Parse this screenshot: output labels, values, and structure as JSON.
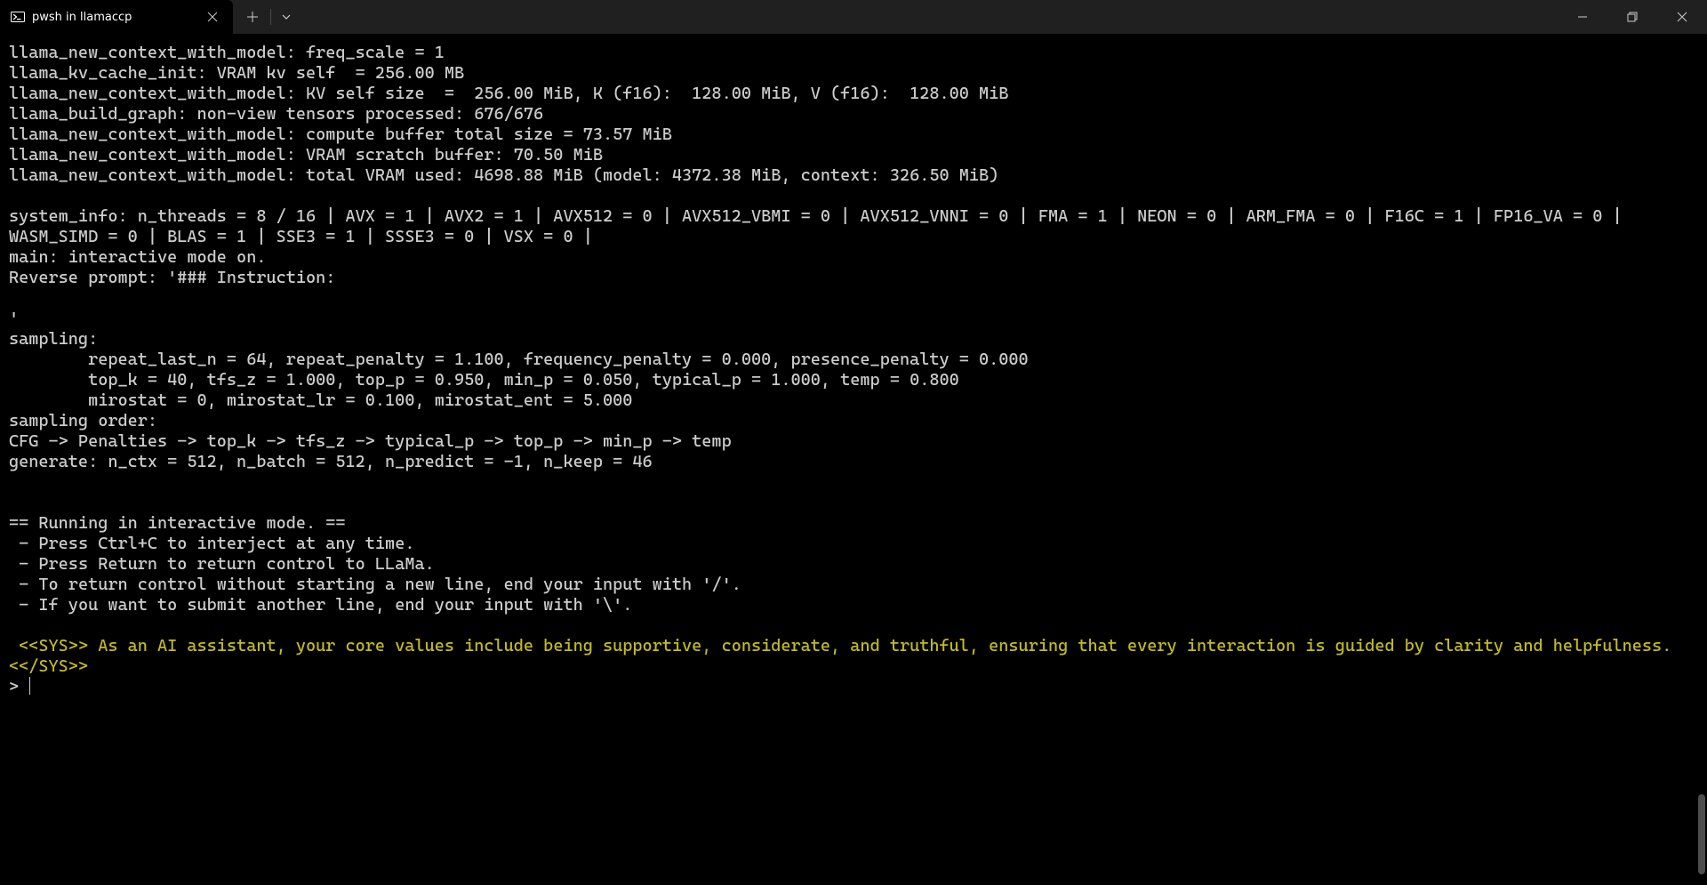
{
  "tab": {
    "title": "pwsh in llamaccp"
  },
  "terminal": {
    "lines": [
      "llama_new_context_with_model: freq_scale = 1",
      "llama_kv_cache_init: VRAM kv self  = 256.00 MB",
      "llama_new_context_with_model: KV self size  =  256.00 MiB, K (f16):  128.00 MiB, V (f16):  128.00 MiB",
      "llama_build_graph: non-view tensors processed: 676/676",
      "llama_new_context_with_model: compute buffer total size = 73.57 MiB",
      "llama_new_context_with_model: VRAM scratch buffer: 70.50 MiB",
      "llama_new_context_with_model: total VRAM used: 4698.88 MiB (model: 4372.38 MiB, context: 326.50 MiB)",
      "",
      "system_info: n_threads = 8 / 16 | AVX = 1 | AVX2 = 1 | AVX512 = 0 | AVX512_VBMI = 0 | AVX512_VNNI = 0 | FMA = 1 | NEON = 0 | ARM_FMA = 0 | F16C = 1 | FP16_VA = 0 | WASM_SIMD = 0 | BLAS = 1 | SSE3 = 1 | SSSE3 = 0 | VSX = 0 |",
      "main: interactive mode on.",
      "Reverse prompt: '### Instruction:",
      "",
      "'",
      "sampling:",
      "        repeat_last_n = 64, repeat_penalty = 1.100, frequency_penalty = 0.000, presence_penalty = 0.000",
      "        top_k = 40, tfs_z = 1.000, top_p = 0.950, min_p = 0.050, typical_p = 1.000, temp = 0.800",
      "        mirostat = 0, mirostat_lr = 0.100, mirostat_ent = 5.000",
      "sampling order:",
      "CFG -> Penalties -> top_k -> tfs_z -> typical_p -> top_p -> min_p -> temp",
      "generate: n_ctx = 512, n_batch = 512, n_predict = -1, n_keep = 46",
      "",
      "",
      "== Running in interactive mode. ==",
      " - Press Ctrl+C to interject at any time.",
      " - Press Return to return control to LLaMa.",
      " - To return control without starting a new line, end your input with '/'.",
      " - If you want to submit another line, end your input with '\\'.",
      ""
    ],
    "sys_text": " <<SYS>> As an AI assistant, your core values include being supportive, considerate, and truthful, ensuring that every interaction is guided by clarity and helpfulness. <</SYS>>",
    "prompt": "> "
  }
}
